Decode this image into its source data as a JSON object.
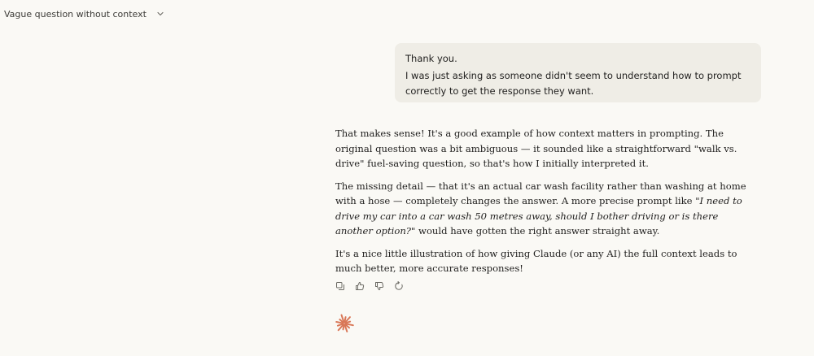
{
  "header": {
    "title": "Vague question without context",
    "dropdown_icon": "chevron-down-icon"
  },
  "user_message": {
    "line1": "Thank you.",
    "line2": "I was just asking as someone didn't seem to understand how to prompt correctly to get the response they want."
  },
  "assistant_message": {
    "p1": "That makes sense! It's a good example of how context matters in prompting. The original question was a bit ambiguous — it sounded like a straightforward \"walk vs. drive\" fuel-saving question, so that's how I initially interpreted it.",
    "p2_before": "The missing detail — that it's an actual car wash facility rather than washing at home with a hose — completely changes the answer. A more precise prompt like ",
    "p2_quote": "\"I need to drive my car into a car wash 50 metres away, should I bother driving or is there another option?\"",
    "p2_after": " would have gotten the right answer straight away.",
    "p3": "It's a nice little illustration of how giving Claude (or any AI) the full context leads to much better, more accurate responses!"
  },
  "actions": {
    "icons": [
      "copy-icon",
      "thumbs-up-icon",
      "thumbs-down-icon",
      "retry-icon"
    ]
  },
  "colors": {
    "background": "#faf9f5",
    "user_bubble": "#efede6",
    "text": "#1f1e1d",
    "icon": "#6b6a64",
    "brand": "#d97757"
  },
  "logo_icon": "claude-spark-icon"
}
